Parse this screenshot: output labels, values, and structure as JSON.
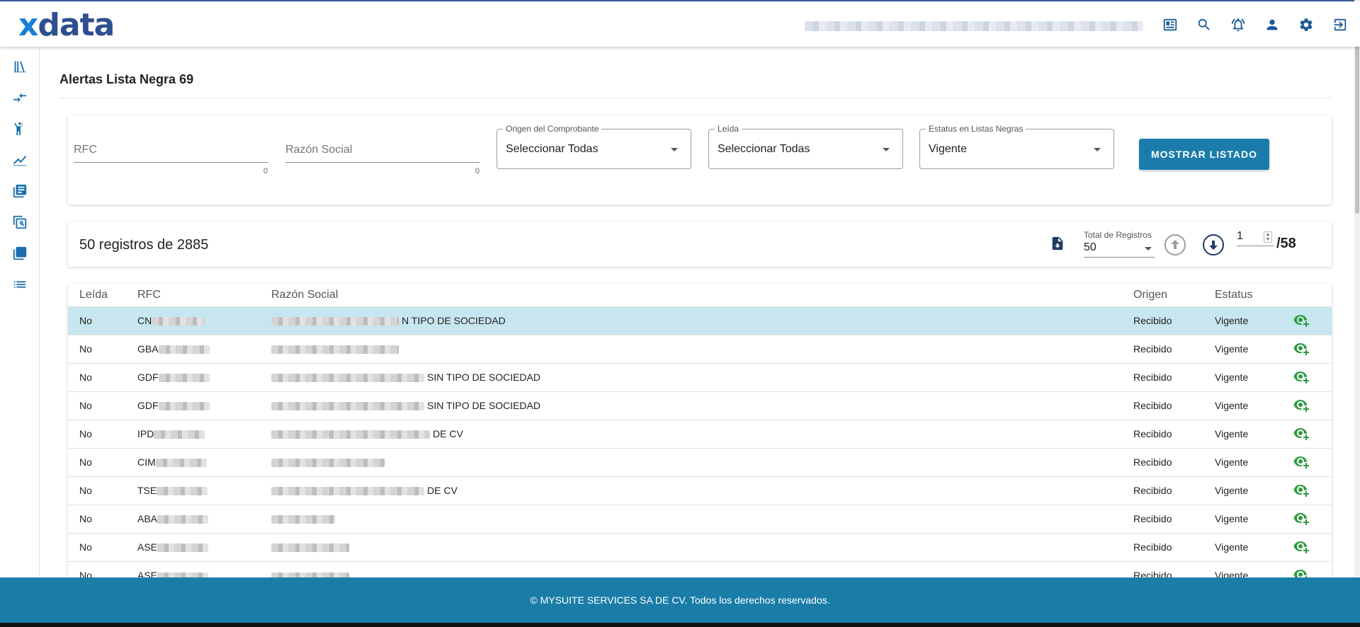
{
  "brand": {
    "logo_x": "x",
    "logo_rest": "data"
  },
  "page": {
    "title": "Alertas Lista Negra 69"
  },
  "filters": {
    "rfc": {
      "label": "RFC",
      "count": "0"
    },
    "razon_social": {
      "label": "Razón Social",
      "count": "0"
    },
    "origen": {
      "label": "Origen del Comprobante",
      "value": "Seleccionar Todas"
    },
    "leida": {
      "label": "Leída",
      "value": "Seleccionar Todas"
    },
    "estatus": {
      "label": "Estatus en Listas Negras",
      "value": "Vigente"
    },
    "submit_label": "MOSTRAR LISTADO"
  },
  "pager": {
    "summary": "50 registros de 2885",
    "per_page_label": "Total de Registros",
    "per_page_value": "50",
    "page_value": "1",
    "page_total": "/58"
  },
  "table": {
    "headers": [
      "Leída",
      "RFC",
      "Razón Social",
      "Origen",
      "Estatus"
    ],
    "rows": [
      {
        "leida": "No",
        "rfc_prefix": "CN",
        "rs_suffix": "N TIPO DE SOCIEDAD",
        "origen": "Recibido",
        "estatus": "Vigente"
      },
      {
        "leida": "No",
        "rfc_prefix": "GBA",
        "rs_suffix": "",
        "origen": "Recibido",
        "estatus": "Vigente"
      },
      {
        "leida": "No",
        "rfc_prefix": "GDF",
        "rs_suffix": "SIN TIPO DE SOCIEDAD",
        "origen": "Recibido",
        "estatus": "Vigente"
      },
      {
        "leida": "No",
        "rfc_prefix": "GDF",
        "rs_suffix": "SIN TIPO DE SOCIEDAD",
        "origen": "Recibido",
        "estatus": "Vigente"
      },
      {
        "leida": "No",
        "rfc_prefix": "IPD",
        "rs_suffix": "DE CV",
        "origen": "Recibido",
        "estatus": "Vigente"
      },
      {
        "leida": "No",
        "rfc_prefix": "CIM",
        "rs_suffix": "",
        "origen": "Recibido",
        "estatus": "Vigente"
      },
      {
        "leida": "No",
        "rfc_prefix": "TSE",
        "rs_suffix": "DE CV",
        "origen": "Recibido",
        "estatus": "Vigente"
      },
      {
        "leida": "No",
        "rfc_prefix": "ABA",
        "rs_suffix": "",
        "origen": "Recibido",
        "estatus": "Vigente"
      },
      {
        "leida": "No",
        "rfc_prefix": "ASE",
        "rs_suffix": "",
        "origen": "Recibido",
        "estatus": "Vigente"
      },
      {
        "leida": "No",
        "rfc_prefix": "ASE",
        "rs_suffix": "",
        "origen": "Recibido",
        "estatus": "Vigente"
      }
    ]
  },
  "footer": {
    "text": "© MYSUITE SERVICES SA DE CV. Todos los derechos reservados."
  },
  "icons": {
    "header": [
      "news-icon",
      "search-icon",
      "alarm-bell-icon",
      "user-icon",
      "settings-gear-icon",
      "logout-icon"
    ],
    "sidebar": [
      "library-icon",
      "compare-arrows-icon",
      "person-alert-icon",
      "line-chart-icon",
      "document-list-icon",
      "find-replace-icon",
      "collections-icon",
      "list-icon"
    ],
    "row_action": "view-add-icon"
  },
  "colors": {
    "accent": "#1b7cab",
    "footer": "#1a7da8",
    "selected_row": "#c7e6ef",
    "eye": "#2e9a3e",
    "logo": "#2d4f8f"
  }
}
